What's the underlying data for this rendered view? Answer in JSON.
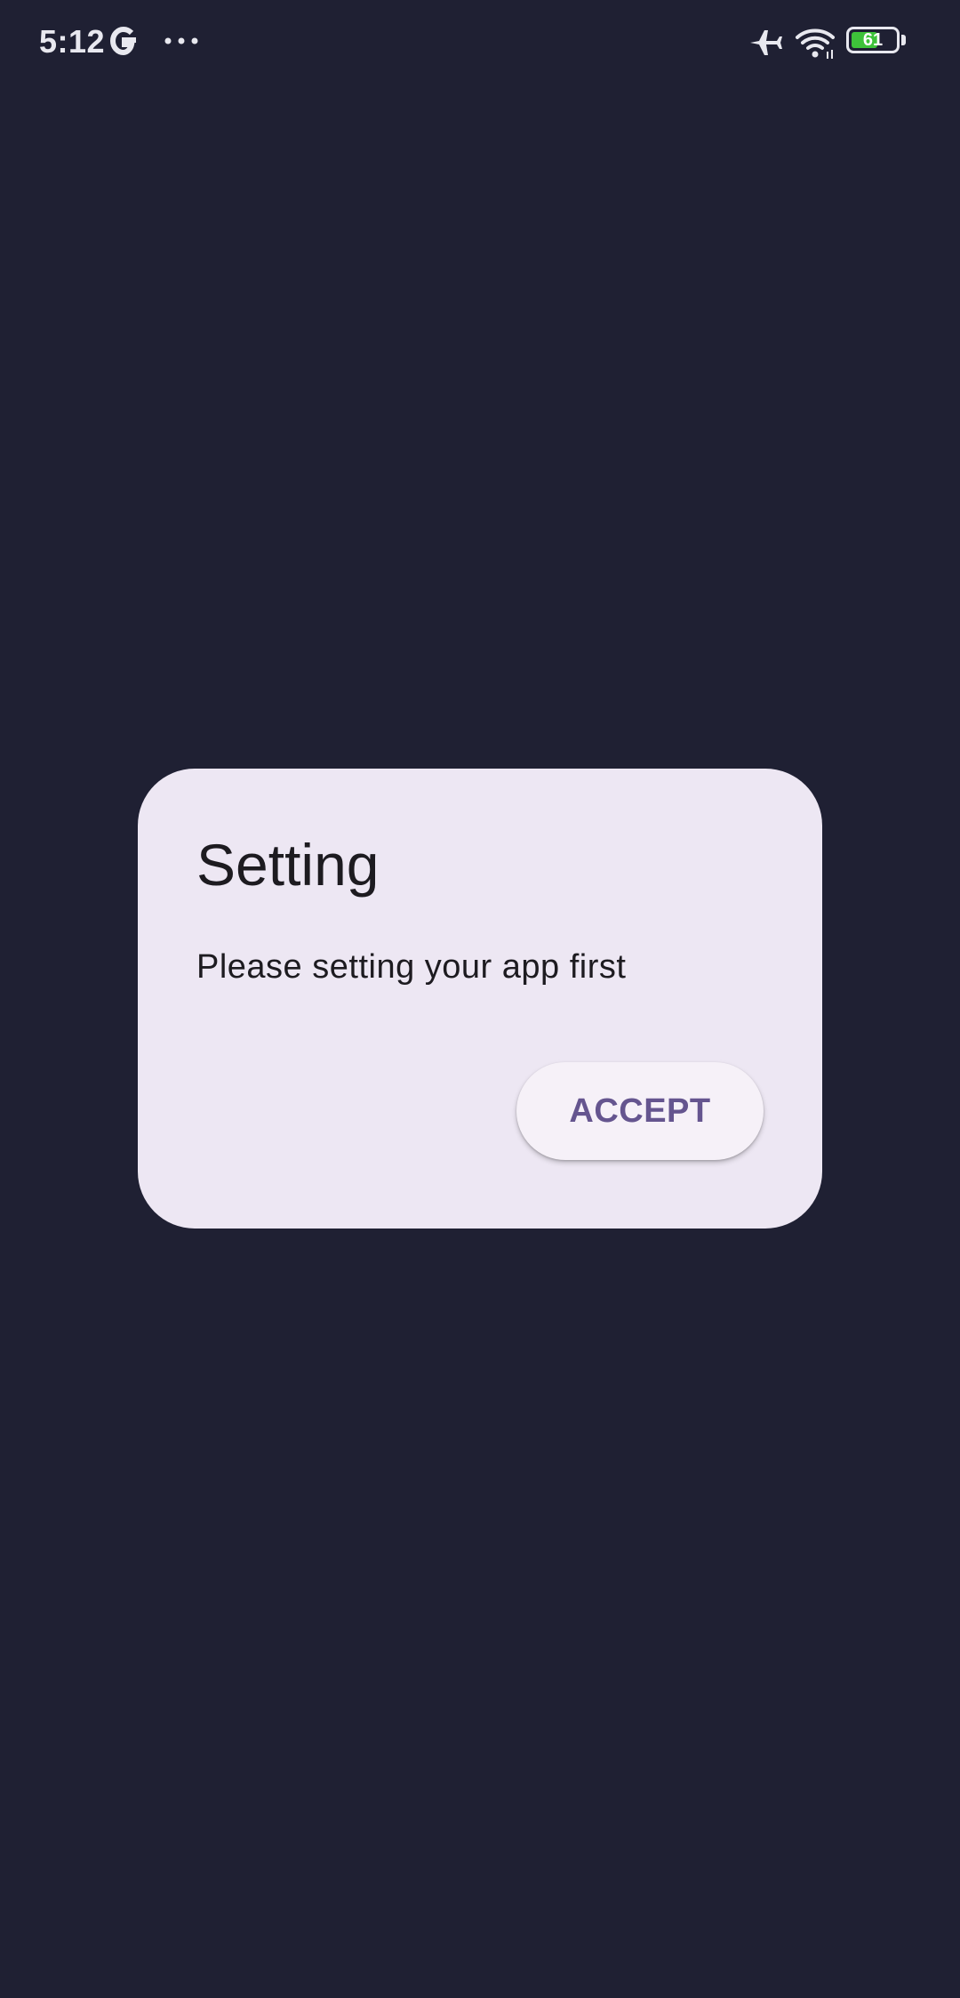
{
  "status_bar": {
    "time": "5:12",
    "battery_level": "61",
    "battery_fraction": 0.61,
    "icons": [
      "google-g-icon",
      "more-dots-icon",
      "airplane-mode-icon",
      "wifi-icon",
      "battery-icon"
    ],
    "battery_fill_color": "#3ec23a"
  },
  "dialog": {
    "title": "Setting",
    "message": "Please setting your app first",
    "accept_label": "ACCEPT"
  },
  "colors": {
    "background": "#1f2033",
    "dialog_surface": "#ede7f3",
    "button_text": "#65558f",
    "text_primary": "#1d1b20"
  }
}
